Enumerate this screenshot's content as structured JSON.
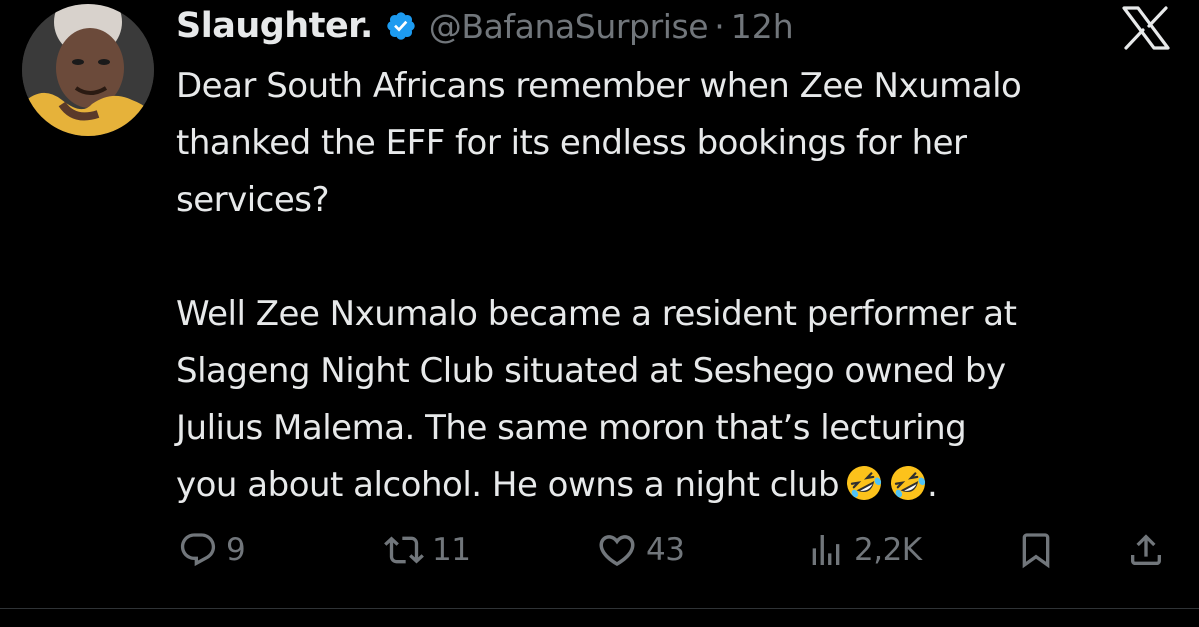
{
  "author": {
    "display_name": "Slaughter.",
    "handle": "@BafanaSurprise",
    "separator": "·",
    "time": "12h",
    "verified": true
  },
  "tweet": {
    "paragraph_1": [
      "Dear South Africans remember when Zee Nxumalo",
      "thanked the EFF for its endless bookings for her",
      "services?"
    ],
    "paragraph_2": [
      "Well Zee Nxumalo became a resident performer at",
      "Slageng Night Club situated at Seshego owned by",
      "Julius Malema. The same moron that’s lecturing",
      "you about alcohol. He owns a night club"
    ],
    "trailing_punctuation": ".",
    "emojis": [
      "rolling-on-floor-laughing-emoji",
      "rolling-on-floor-laughing-emoji"
    ]
  },
  "actions": {
    "replies": "9",
    "reposts": "11",
    "likes": "43",
    "views": "2,2K"
  },
  "icons": {
    "verified": "verified-badge-icon",
    "brand": "x-logo-icon",
    "reply": "reply-icon",
    "repost": "repost-icon",
    "like": "heart-icon",
    "views": "views-icon",
    "bookmark": "bookmark-icon",
    "share": "share-icon"
  },
  "colors": {
    "background": "#000000",
    "text": "#e7e9ea",
    "secondary": "#71767b",
    "verified": "#1d9bf0"
  }
}
